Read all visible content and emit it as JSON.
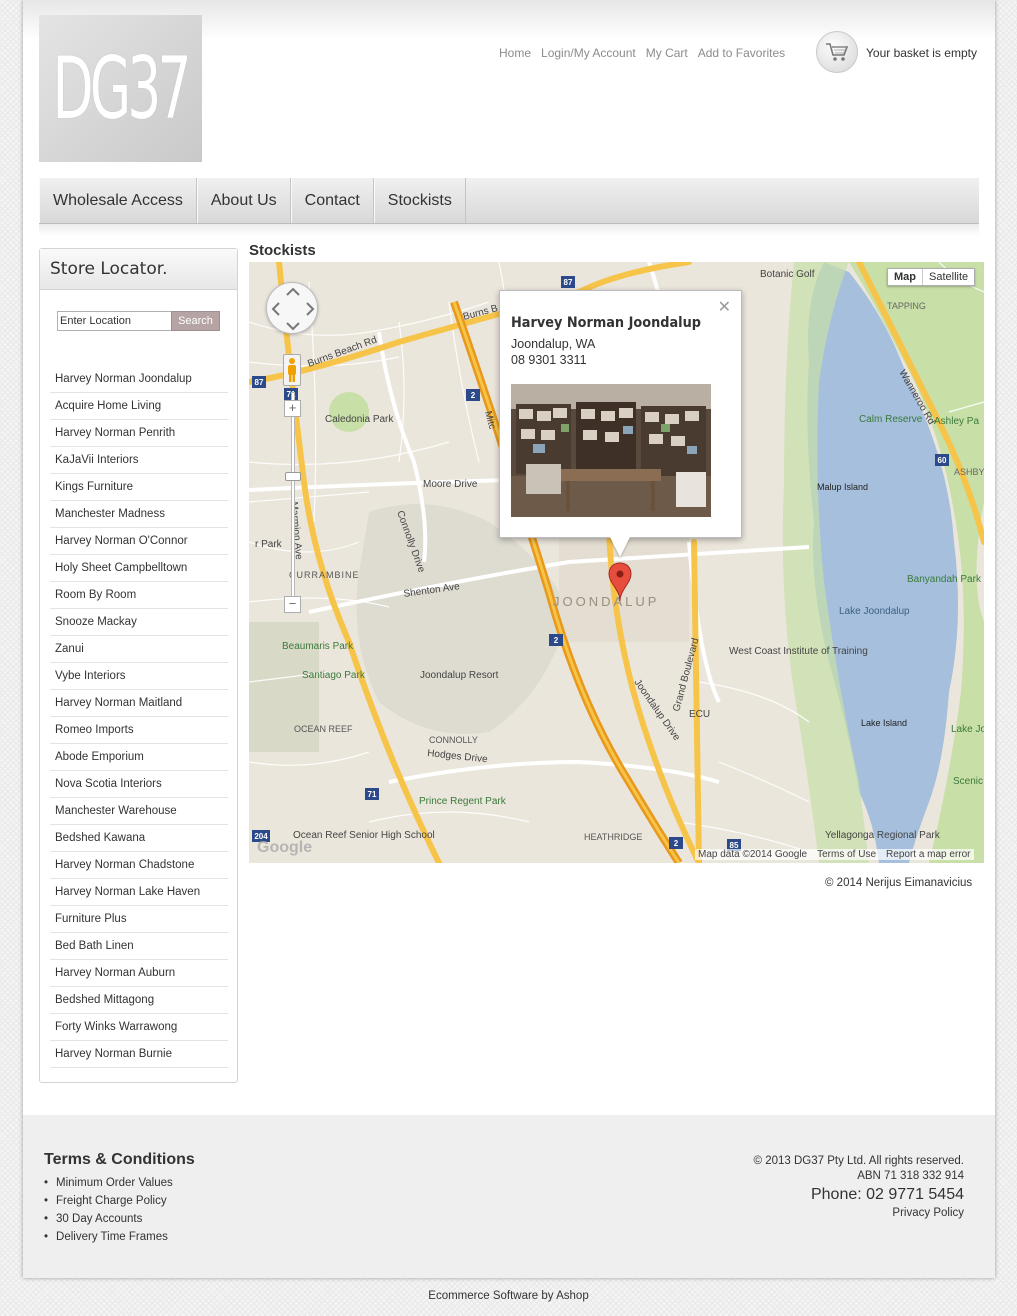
{
  "header": {
    "logo_text": "DG37",
    "links": [
      "Home",
      "Login/My Account",
      "My Cart",
      "Add to Favorites"
    ],
    "basket_text": "Your basket is empty",
    "basket_icon": "shopping-cart-icon"
  },
  "nav": {
    "items": [
      "Wholesale Access",
      "About Us",
      "Contact",
      "Stockists"
    ]
  },
  "sidebar": {
    "title": "Store Locator.",
    "search_placeholder": "Enter Location",
    "search_button": "Search",
    "stores": [
      "Harvey Norman Joondalup",
      "Acquire Home Living",
      "Harvey Norman Penrith",
      "KaJaVii Interiors",
      "Kings Furniture",
      "Manchester Madness",
      "Harvey Norman O'Connor",
      "Holy Sheet Campbelltown",
      "Room By Room",
      "Snooze Mackay",
      "Zanui",
      "Vybe Interiors",
      "Harvey Norman Maitland",
      "Romeo Imports",
      "Abode Emporium",
      "Nova Scotia Interiors",
      "Manchester Warehouse",
      "Bedshed Kawana",
      "Harvey Norman Chadstone",
      "Harvey Norman Lake Haven",
      "Furniture Plus",
      "Bed Bath Linen",
      "Harvey Norman Auburn",
      "Bedshed Mittagong",
      "Forty Winks Warrawong",
      "Harvey Norman Burnie"
    ]
  },
  "main": {
    "title": "Stockists",
    "copyright": "© 2014 Nerijus Eimanavicius"
  },
  "map": {
    "type_map": "Map",
    "type_satellite": "Satellite",
    "popup": {
      "title": "Harvey Norman Joondalup",
      "line1": "Joondalup, WA",
      "line2": "08 9301 3311"
    },
    "labels": {
      "botanic_golf": "Botanic Golf",
      "tapping": "TAPPING",
      "burns_beach_rd": "Burns Beach Rd",
      "burns": "Burns B",
      "caledonia_park": "Caledonia Park",
      "calm_reserve": "Calm Reserve",
      "ashley_pa": "Ashley Pa",
      "ashby": "ASHBY",
      "wanneroo_rd": "Wanneroo Rd",
      "malup_island": "Malup Island",
      "moore_drive": "Moore Drive",
      "connolly_drive": "Connolly Drive",
      "marmion_ave": "Marmion Ave",
      "currambine": "CURRAMBINE",
      "shenton_ave": "Shenton Ave",
      "joondalup": "JOONDALUP",
      "banyandah_park": "Banyandah Park",
      "lake_joondalup": "Lake Joondalup",
      "beaumaris_park": "Beaumaris Park",
      "santiago_park": "Santiago Park",
      "joondalup_resort": "Joondalup Resort",
      "west_coast": "West Coast Institute of Training",
      "ocean_reef": "OCEAN REEF",
      "connolly": "CONNOLLY",
      "hodges_drive": "Hodges Drive",
      "ecu": "ECU",
      "lake_island": "Lake Island",
      "lake_joondalup_park": "Lake Joondalup Park",
      "scenic_drive_park": "Scenic Drive Park",
      "grand_boulevard": "Grand Boulevard",
      "joondalup_drive": "Joondalup Drive",
      "prince_regent_park": "Prince Regent Park",
      "heathridge": "HEATHRIDGE",
      "ocean_reef_school": "Ocean Reef Senior High School",
      "yellagonga": "Yellagonga Regional Park",
      "r_park": "r Park",
      "mitc": "Mitc"
    },
    "route_shields": [
      "87",
      "87",
      "2",
      "71",
      "2",
      "2",
      "71",
      "204",
      "60",
      "2",
      "85"
    ],
    "footer": [
      "Map data ©2014 Google",
      "Terms of Use",
      "Report a map error"
    ],
    "google_logo": "Google"
  },
  "footer": {
    "title": "Terms & Conditions",
    "links": [
      "Minimum Order Values",
      "Freight Charge Policy",
      "30 Day Accounts",
      "Delivery Time Frames"
    ],
    "company": "© 2013 DG37 Pty Ltd. All rights reserved.",
    "abn": "ABN 71 318 332 914",
    "phone": "Phone: 02 9771 5454",
    "privacy": "Privacy Policy"
  },
  "credit": "Ecommerce Software by Ashop",
  "colors": {
    "map_water": "#a5bfdd",
    "map_park": "#c8dfa8",
    "map_land": "#ebe6dc",
    "road_major": "#f7c44a",
    "freeway": "#e8981a",
    "marker": "#e74c3c",
    "search_button": "#b6a4a4"
  }
}
